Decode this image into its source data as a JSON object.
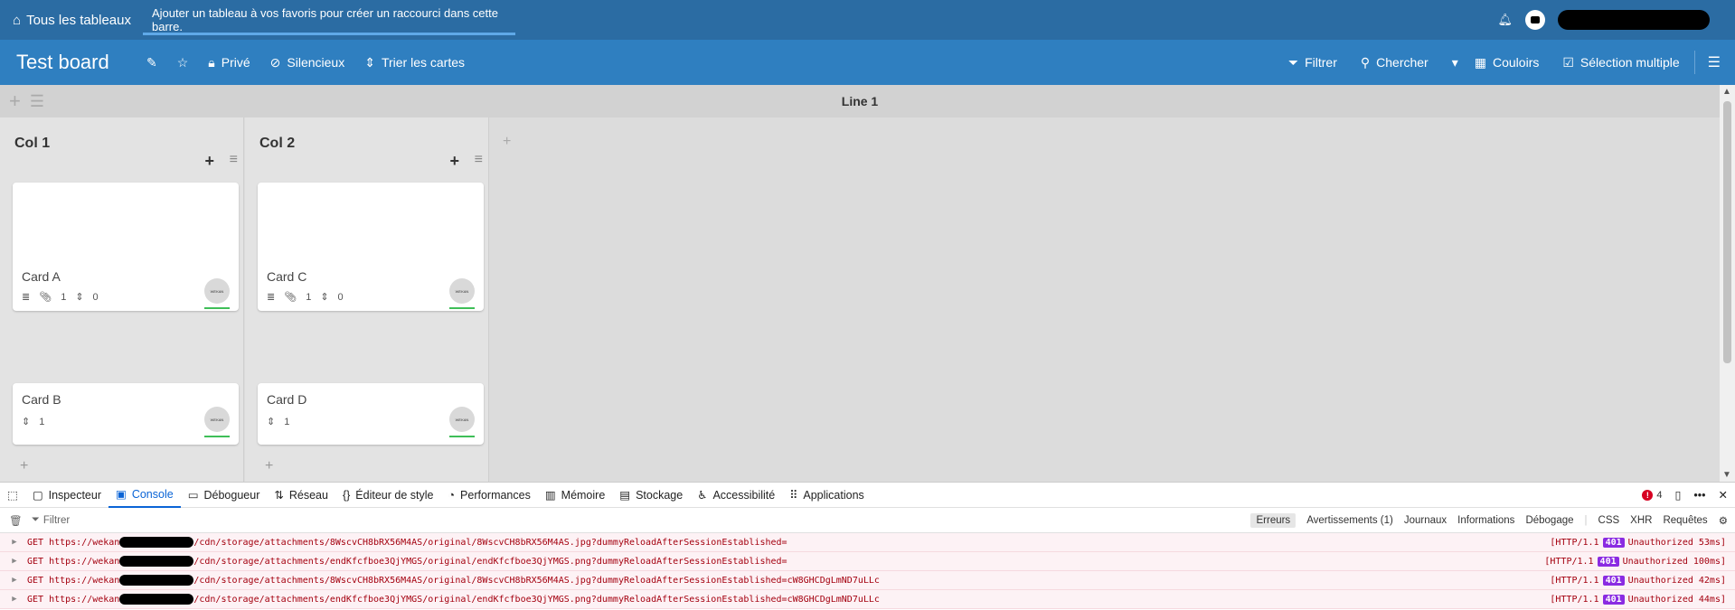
{
  "topbar": {
    "home_label": "Tous les tableaux",
    "hint": "Ajouter un tableau à vos favoris pour créer un raccourci dans cette barre."
  },
  "board": {
    "title": "Test board",
    "privacy": "Privé",
    "watch": "Silencieux",
    "sort": "Trier les cartes",
    "filter": "Filtrer",
    "search": "Chercher",
    "view": "Couloirs",
    "multiselect": "Sélection multiple"
  },
  "swimlane": {
    "title": "Line 1"
  },
  "lists": [
    {
      "title": "Col 1",
      "cards": [
        {
          "title": "Card A",
          "attachments": "1",
          "checklist": "0",
          "avatar": "WEKAN"
        },
        {
          "title": "Card B",
          "sort": "1",
          "avatar": "WEKAN"
        }
      ]
    },
    {
      "title": "Col 2",
      "cards": [
        {
          "title": "Card C",
          "attachments": "1",
          "checklist": "0",
          "avatar": "WEKAN"
        },
        {
          "title": "Card D",
          "sort": "1",
          "avatar": "WEKAN"
        }
      ]
    }
  ],
  "devtools": {
    "tabs": [
      "Inspecteur",
      "Console",
      "Débogueur",
      "Réseau",
      "Éditeur de style",
      "Performances",
      "Mémoire",
      "Stockage",
      "Accessibilité",
      "Applications"
    ],
    "error_count": "4",
    "filter_placeholder": "Filtrer",
    "levels": [
      "Erreurs",
      "Avertissements (1)",
      "Journaux",
      "Informations",
      "Débogage"
    ],
    "types": [
      "CSS",
      "XHR",
      "Requêtes"
    ],
    "logs": [
      {
        "method": "GET",
        "url_start": "https://wekan",
        "url_end": "/cdn/storage/attachments/8WscvCH8bRX56M4AS/original/8WscvCH8bRX56M4AS.jpg?dummyReloadAfterSessionEstablished=",
        "proto": "[HTTP/1.1",
        "code": "401",
        "status": "Unauthorized 53ms]"
      },
      {
        "method": "GET",
        "url_start": "https://wekan",
        "url_end": "/cdn/storage/attachments/endKfcfboe3QjYMGS/original/endKfcfboe3QjYMGS.png?dummyReloadAfterSessionEstablished=",
        "proto": "[HTTP/1.1",
        "code": "401",
        "status": "Unauthorized 100ms]"
      },
      {
        "method": "GET",
        "url_start": "https://wekan",
        "url_end": "/cdn/storage/attachments/8WscvCH8bRX56M4AS/original/8WscvCH8bRX56M4AS.jpg?dummyReloadAfterSessionEstablished=cW8GHCDgLmND7uLLc",
        "proto": "[HTTP/1.1",
        "code": "401",
        "status": "Unauthorized 42ms]"
      },
      {
        "method": "GET",
        "url_start": "https://wekan",
        "url_end": "/cdn/storage/attachments/endKfcfboe3QjYMGS/original/endKfcfboe3QjYMGS.png?dummyReloadAfterSessionEstablished=cW8GHCDgLmND7uLLc",
        "proto": "[HTTP/1.1",
        "code": "401",
        "status": "Unauthorized 44ms]"
      }
    ]
  }
}
